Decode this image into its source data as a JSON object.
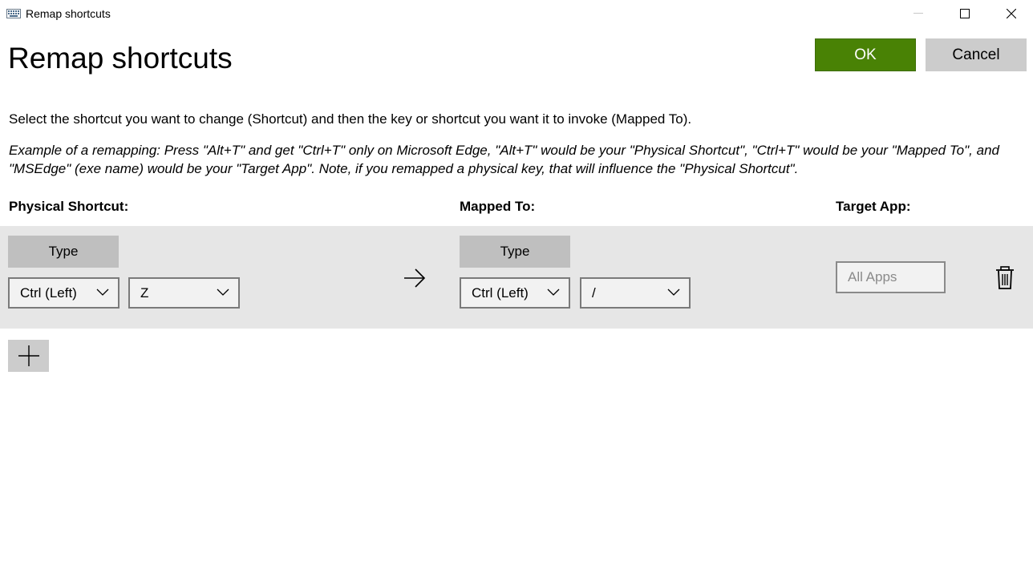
{
  "window": {
    "title": "Remap shortcuts",
    "icon": "keyboard-icon",
    "controls": [
      "minimize-icon",
      "maximize-icon",
      "close-icon"
    ]
  },
  "page": {
    "title": "Remap shortcuts",
    "instruction": "Select the shortcut you want to change (Shortcut) and then the key or shortcut you want it to invoke (Mapped To).",
    "example": "Example of a remapping: Press \"Alt+T\" and get \"Ctrl+T\" only on Microsoft Edge, \"Alt+T\" would be your \"Physical Shortcut\", \"Ctrl+T\" would be your \"Mapped To\", and \"MSEdge\" (exe name) would be your \"Target App\". Note, if you remapped a physical key, that will influence the \"Physical Shortcut\"."
  },
  "actions": {
    "ok_label": "OK",
    "cancel_label": "Cancel"
  },
  "columns": {
    "physical": "Physical Shortcut:",
    "mapped": "Mapped To:",
    "target": "Target App:"
  },
  "mapping": {
    "physical": {
      "type_label": "Type",
      "modifier": "Ctrl (Left)",
      "key": "Z"
    },
    "mapped": {
      "type_label": "Type",
      "modifier": "Ctrl (Left)",
      "key": "/"
    },
    "target_placeholder": "All Apps"
  },
  "colors": {
    "ok_bg": "#498205",
    "row_bg": "#e6e6e6",
    "button_gray": "#cccccc"
  },
  "icons": {
    "arrow": "arrow-right-icon",
    "delete": "trash-icon",
    "add": "plus-icon"
  }
}
